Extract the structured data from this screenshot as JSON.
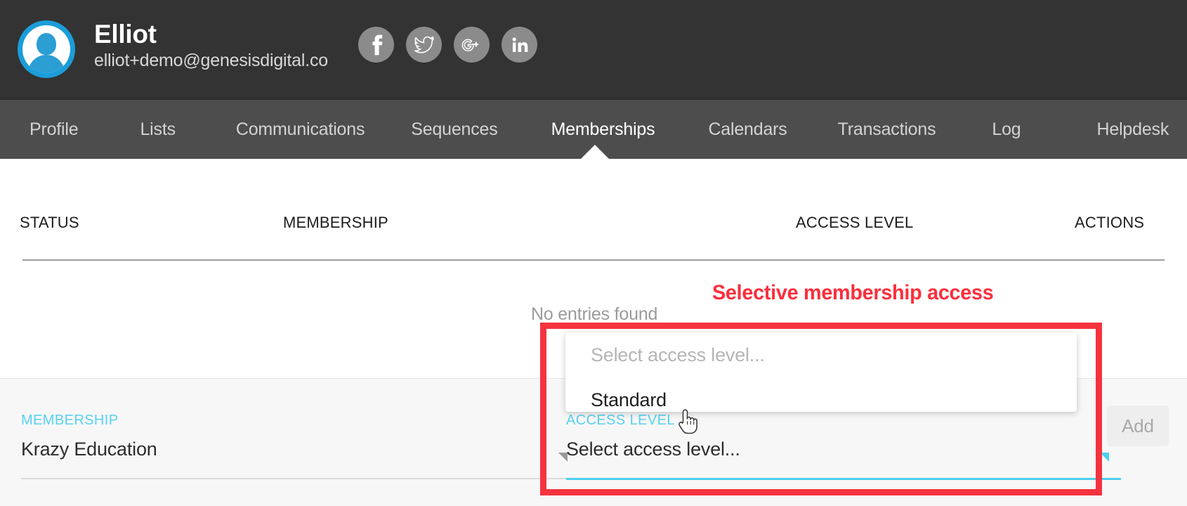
{
  "header": {
    "user_name": "Elliot",
    "user_email": "elliot+demo@genesisdigital.co",
    "avatar_icon": "user-avatar-icon",
    "social": [
      {
        "name": "facebook",
        "icon": "facebook-icon",
        "label": "f"
      },
      {
        "name": "twitter",
        "icon": "twitter-icon",
        "label": "t"
      },
      {
        "name": "googleplus",
        "icon": "google-plus-icon",
        "label": "g+"
      },
      {
        "name": "linkedin",
        "icon": "linkedin-icon",
        "label": "in"
      }
    ]
  },
  "nav": {
    "active": "Memberships",
    "items": [
      {
        "label": "Profile"
      },
      {
        "label": "Lists"
      },
      {
        "label": "Communications"
      },
      {
        "label": "Sequences"
      },
      {
        "label": "Memberships"
      },
      {
        "label": "Calendars"
      },
      {
        "label": "Transactions"
      },
      {
        "label": "Log"
      },
      {
        "label": "Helpdesk"
      }
    ]
  },
  "table": {
    "columns": [
      "STATUS",
      "MEMBERSHIP",
      "ACCESS LEVEL",
      "ACTIONS"
    ],
    "rows": [],
    "empty_message": "No entries found"
  },
  "form": {
    "membership": {
      "label": "MEMBERSHIP",
      "value": "Krazy Education",
      "caret_icon": "triangle-down-icon"
    },
    "access_level": {
      "label": "ACCESS LEVEL",
      "value": "Select access level...",
      "caret_icon": "triangle-down-icon"
    },
    "add_label": "Add"
  },
  "dropdown": {
    "open": true,
    "options": [
      {
        "label": "Select access level...",
        "kind": "placeholder"
      },
      {
        "label": "Standard",
        "kind": "item"
      }
    ]
  },
  "annotation": {
    "text": "Selective membership access",
    "color": "#fa2f3c"
  },
  "cursor": {
    "icon": "pointing-hand-cursor"
  },
  "colors": {
    "header_bg": "#333333",
    "nav_bg": "#4d4d4d",
    "accent_cyan": "#4ccfee",
    "label_cyan": "#57d2ef",
    "avatar_blue": "#1b9dd9",
    "annotation_red": "#f5333f",
    "panel_bg": "#f7f7f7"
  }
}
